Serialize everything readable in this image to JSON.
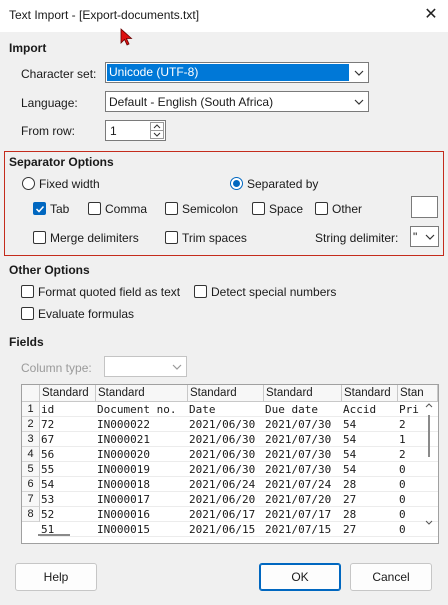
{
  "window": {
    "title": "Text Import - [Export-documents.txt]",
    "close_glyph": "✕"
  },
  "import": {
    "section": "Import",
    "charset_label": "Character set:",
    "charset_value": "Unicode (UTF-8)",
    "language_label": "Language:",
    "language_value": "Default - English (South Africa)",
    "from_row_label": "From row:",
    "from_row_value": "1"
  },
  "separator": {
    "section": "Separator Options",
    "fixed_width": "Fixed width",
    "separated_by": "Separated by",
    "selected_mode": "separated_by",
    "tab": "Tab",
    "comma": "Comma",
    "semicolon": "Semicolon",
    "space": "Space",
    "other": "Other",
    "merge_delimiters": "Merge delimiters",
    "trim_spaces": "Trim spaces",
    "string_delimiter_label": "String delimiter:",
    "string_delimiter_value": "\"",
    "checked": {
      "tab": true,
      "comma": false,
      "semicolon": false,
      "space": false,
      "other": false,
      "merge": false,
      "trim": false
    }
  },
  "other_options": {
    "section": "Other Options",
    "format_quoted": "Format quoted field as text",
    "detect_special": "Detect special numbers",
    "evaluate_formulas": "Evaluate formulas"
  },
  "fields": {
    "section": "Fields",
    "column_type_label": "Column type:",
    "column_type_value": "",
    "headers": [
      "Standard",
      "Standard",
      "Standard",
      "Standard",
      "Standard",
      "Stan"
    ],
    "row_numbers": [
      "1",
      "2",
      "3",
      "4",
      "5",
      "6",
      "7",
      "8"
    ],
    "rows": [
      [
        "id",
        "Document no.",
        "Date",
        "Due date",
        "Accid",
        "Pri"
      ],
      [
        "72",
        "IN000022",
        "2021/06/30",
        "2021/07/30",
        "54",
        "2"
      ],
      [
        "67",
        "IN000021",
        "2021/06/30",
        "2021/07/30",
        "54",
        "1"
      ],
      [
        "56",
        "IN000020",
        "2021/06/30",
        "2021/07/30",
        "54",
        "2"
      ],
      [
        "55",
        "IN000019",
        "2021/06/30",
        "2021/07/30",
        "54",
        "0"
      ],
      [
        "54",
        "IN000018",
        "2021/06/24",
        "2021/07/24",
        "28",
        "0"
      ],
      [
        "53",
        "IN000017",
        "2021/06/20",
        "2021/07/20",
        "27",
        "0"
      ],
      [
        "52",
        "IN000016",
        "2021/06/17",
        "2021/07/17",
        "28",
        "0"
      ],
      [
        "51",
        "IN000015",
        "2021/06/15",
        "2021/07/15",
        "27",
        "0"
      ]
    ]
  },
  "buttons": {
    "help": "Help",
    "ok": "OK",
    "cancel": "Cancel"
  },
  "colors": {
    "accent": "#0067c0",
    "selection": "#0078d7",
    "separator_border": "#c42b1c"
  }
}
